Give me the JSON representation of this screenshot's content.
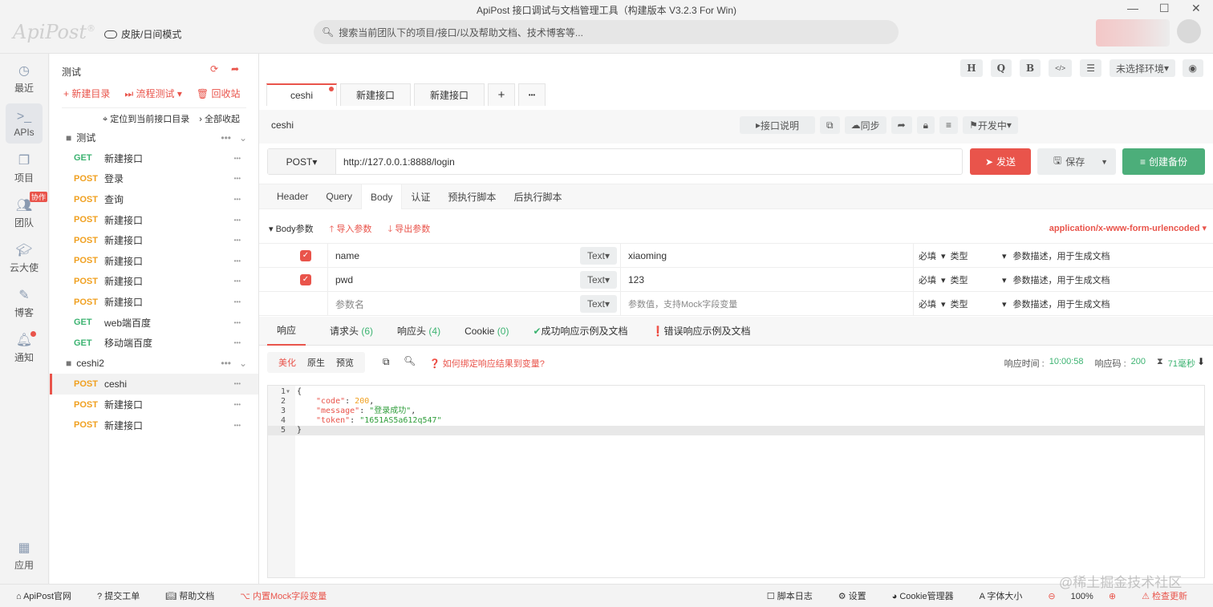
{
  "window": {
    "title": "ApiPost 接口调试与文档管理工具（构建版本 V3.2.3 For Win)",
    "minimize": "—",
    "maximize": "☐",
    "close": "✕"
  },
  "header": {
    "logo": "ApiPost",
    "logo_mark": "®",
    "skin_mode": "皮肤/日间模式",
    "search_placeholder": "搜索当前团队下的项目/接口/以及帮助文档、技术博客等..."
  },
  "rail": [
    {
      "label": "最近",
      "icon": "clock"
    },
    {
      "label": "APIs",
      "icon": "terminal"
    },
    {
      "label": "项目",
      "icon": "project"
    },
    {
      "label": "团队",
      "icon": "team",
      "badge": "协作"
    },
    {
      "label": "云大使",
      "icon": "graduation"
    },
    {
      "label": "博客",
      "icon": "edit"
    },
    {
      "label": "通知",
      "icon": "bell"
    },
    {
      "label": "应用",
      "icon": "grid"
    }
  ],
  "tree": {
    "project": "测试",
    "new_folder": "+ 新建目录",
    "flow_test": "流程测试",
    "recycle": "回收站",
    "locate": "定位到当前接口目录",
    "collapse_all": "全部收起",
    "folders": [
      {
        "name": "测试",
        "items": [
          {
            "method": "GET",
            "name": "新建接口"
          },
          {
            "method": "POST",
            "name": "登录"
          },
          {
            "method": "POST",
            "name": "查询"
          },
          {
            "method": "POST",
            "name": "新建接口"
          },
          {
            "method": "POST",
            "name": "新建接口"
          },
          {
            "method": "POST",
            "name": "新建接口"
          },
          {
            "method": "POST",
            "name": "新建接口"
          },
          {
            "method": "POST",
            "name": "新建接口"
          },
          {
            "method": "GET",
            "name": "web端百度"
          },
          {
            "method": "GET",
            "name": "移动端百度"
          }
        ]
      },
      {
        "name": "ceshi2",
        "items": [
          {
            "method": "POST",
            "name": "ceshi"
          },
          {
            "method": "POST",
            "name": "新建接口"
          },
          {
            "method": "POST",
            "name": "新建接口"
          }
        ]
      }
    ]
  },
  "toolbar": {
    "h": "H",
    "q": "Q",
    "b": "B",
    "code": "</>",
    "sliders": "☰",
    "env": "未选择环境",
    "eye": "👁"
  },
  "tabs": [
    "ceshi",
    "新建接口",
    "新建接口"
  ],
  "tab_add": "+",
  "tab_more": "•••",
  "api": {
    "name": "ceshi",
    "doc": "接口说明",
    "sync": "同步",
    "status": "开发中",
    "method": "POST",
    "url": "http://127.0.0.1:8888/login",
    "send": "发送",
    "save": "保存",
    "backup": "创建备份"
  },
  "req_tabs": [
    "Header",
    "Query",
    "Body",
    "认证",
    "预执行脚本",
    "后执行脚本"
  ],
  "body": {
    "label": "Body参数",
    "import": "导入参数",
    "export": "导出参数",
    "content_type": "application/x-www-form-urlencoded",
    "rows": [
      {
        "checked": true,
        "key": "name",
        "type": "Text",
        "value": "xiaoming",
        "required": "必填",
        "vtype": "类型",
        "desc": "参数描述，用于生成文档"
      },
      {
        "checked": true,
        "key": "pwd",
        "type": "Text",
        "value": "123",
        "required": "必填",
        "vtype": "类型",
        "desc": "参数描述，用于生成文档"
      },
      {
        "checked": false,
        "key": "参数名",
        "type": "Text",
        "value": "参数值，支持Mock字段变量",
        "required": "必填",
        "vtype": "类型",
        "desc": "参数描述，用于生成文档"
      }
    ]
  },
  "resp_tabs": {
    "response": "响应",
    "req_headers": "请求头",
    "req_headers_count": "(6)",
    "resp_headers": "响应头",
    "resp_headers_count": "(4)",
    "cookie": "Cookie",
    "cookie_count": "(0)",
    "success_doc": "成功响应示例及文档",
    "error_doc": "错误响应示例及文档"
  },
  "resp_bar": {
    "beautify": "美化",
    "raw": "原生",
    "preview": "预览",
    "help": "如何绑定响应结果到变量?",
    "time_label": "响应时间 :",
    "time": "10:00:58",
    "code_label": "响应码 :",
    "code": "200",
    "duration": "71毫秒"
  },
  "code_lines": [
    {
      "n": "1",
      "t": "{"
    },
    {
      "n": "2",
      "k": "\"code\"",
      "v": "200",
      "vt": "num"
    },
    {
      "n": "3",
      "k": "\"message\"",
      "v": "\"登录成功\"",
      "vt": "str"
    },
    {
      "n": "4",
      "k": "\"token\"",
      "v": "\"1651AS5a612q547\"",
      "vt": "str"
    },
    {
      "n": "5",
      "t": "}"
    }
  ],
  "footer": {
    "site": "ApiPost官网",
    "ticket": "提交工单",
    "help": "帮助文档",
    "mock": "内置Mock字段变量",
    "log": "脚本日志",
    "settings": "设置",
    "cookie": "Cookie管理器",
    "font": "字体大小",
    "zoom": "100%",
    "update": "检查更新",
    "watermark": "@稀土掘金技术社区"
  }
}
